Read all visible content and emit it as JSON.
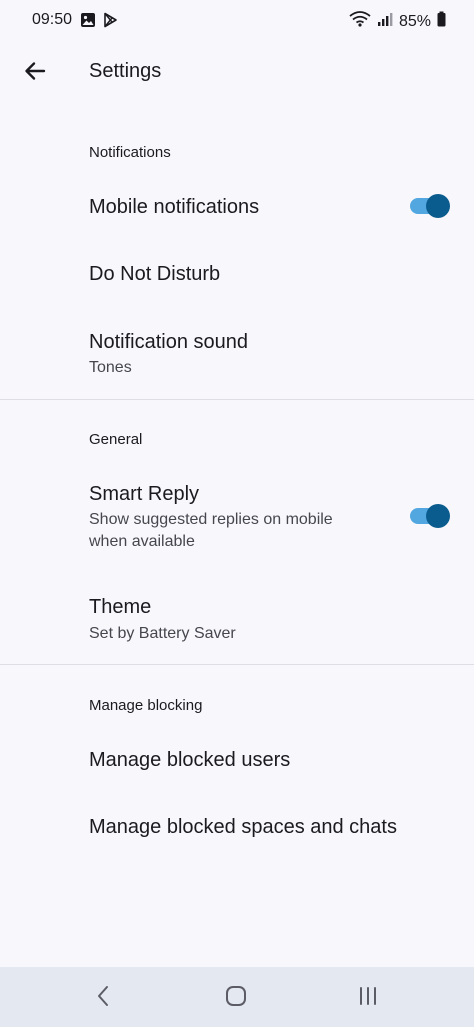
{
  "status_bar": {
    "time": "09:50",
    "battery": "85%",
    "icons": [
      "image-icon",
      "play-store-icon",
      "wifi-icon",
      "signal-icon",
      "battery-icon"
    ]
  },
  "app_bar": {
    "title": "Settings",
    "back_icon": "arrow-left-icon"
  },
  "sections": {
    "notifications": {
      "header": "Notifications",
      "mobile_notifications": {
        "title": "Mobile notifications",
        "enabled": true
      },
      "do_not_disturb": {
        "title": "Do Not Disturb"
      },
      "notification_sound": {
        "title": "Notification sound",
        "subtitle": "Tones"
      }
    },
    "general": {
      "header": "General",
      "smart_reply": {
        "title": "Smart Reply",
        "subtitle_line1": "Show suggested replies on mobile",
        "subtitle_line2": "when available",
        "enabled": true
      },
      "theme": {
        "title": "Theme",
        "subtitle": "Set by Battery Saver"
      }
    },
    "manage_blocking": {
      "header": "Manage blocking",
      "blocked_users": {
        "title": "Manage blocked users"
      },
      "blocked_spaces": {
        "title": "Manage blocked spaces and chats"
      }
    }
  },
  "colors": {
    "background": "#f8f8fc",
    "toggle_track": "#52a7e0",
    "toggle_thumb": "#0b5c8e",
    "nav_bar": "#e4e8f0"
  },
  "nav_bar": {
    "icons": [
      "nav-back-icon",
      "nav-home-icon",
      "nav-recents-icon"
    ]
  }
}
